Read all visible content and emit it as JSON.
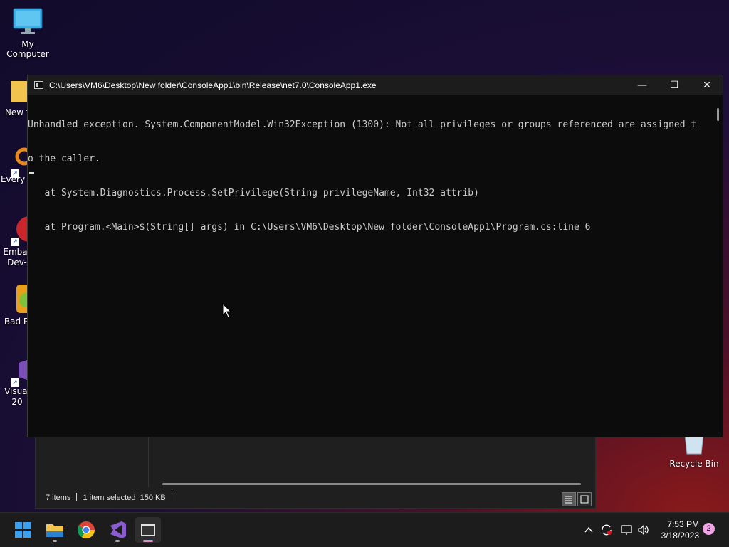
{
  "desktop": {
    "icons": [
      {
        "label": "My Computer"
      },
      {
        "label": "New f"
      },
      {
        "label": "Every"
      },
      {
        "label": "Embar\nDev-"
      },
      {
        "label": "Bad P"
      },
      {
        "label": "Visual\n20"
      },
      {
        "label": "Recycle Bin"
      }
    ]
  },
  "explorer": {
    "item_count": "7 items",
    "selected": "1 item selected",
    "size": "150 KB"
  },
  "console": {
    "title": "C:\\Users\\VM6\\Desktop\\New folder\\ConsoleApp1\\bin\\Release\\net7.0\\ConsoleApp1.exe",
    "lines": [
      "Unhandled exception. System.ComponentModel.Win32Exception (1300): Not all privileges or groups referenced are assigned t",
      "o the caller.",
      "   at System.Diagnostics.Process.SetPrivilege(String privilegeName, Int32 attrib)",
      "   at Program.<Main>$(String[] args) in C:\\Users\\VM6\\Desktop\\New folder\\ConsoleApp1\\Program.cs:line 6"
    ],
    "minimize_glyph": "—",
    "maximize_glyph": "☐",
    "close_glyph": "✕"
  },
  "taskbar": {
    "apps": [
      {
        "icon": "windows-start-icon"
      },
      {
        "icon": "file-explorer-icon"
      },
      {
        "icon": "chrome-icon"
      },
      {
        "icon": "visual-studio-icon"
      },
      {
        "icon": "terminal-icon"
      }
    ],
    "tray": {
      "chevron": "^",
      "time": "7:53 PM",
      "date": "3/18/2023",
      "notifications": "2"
    }
  },
  "colors": {
    "console_bg": "#0c0c0c",
    "console_text": "#cccccc",
    "taskbar_bg": "#1c1c1c",
    "accent_pink": "#f0a4e6"
  }
}
